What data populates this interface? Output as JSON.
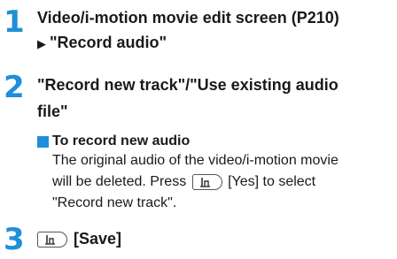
{
  "steps": [
    {
      "number": "1",
      "line1": "Video/i-motion movie edit screen (P210)",
      "line2": "\"Record audio\""
    },
    {
      "number": "2",
      "line1": "\"Record new track\"/\"Use existing audio",
      "line2": "file\"",
      "note": {
        "heading": "To record new audio",
        "line1": "The original audio of the video/i-motion movie",
        "line2a": "will be deleted. Press",
        "line2b": "[Yes] to select",
        "line3": "\"Record new track\"."
      }
    },
    {
      "number": "3",
      "label": "[Save]"
    }
  ],
  "icons": {
    "arrow": "right-triangle-icon",
    "key": "center-key-icon"
  },
  "colors": {
    "accent": "#1e8fd8",
    "text": "#1a1a1a"
  }
}
